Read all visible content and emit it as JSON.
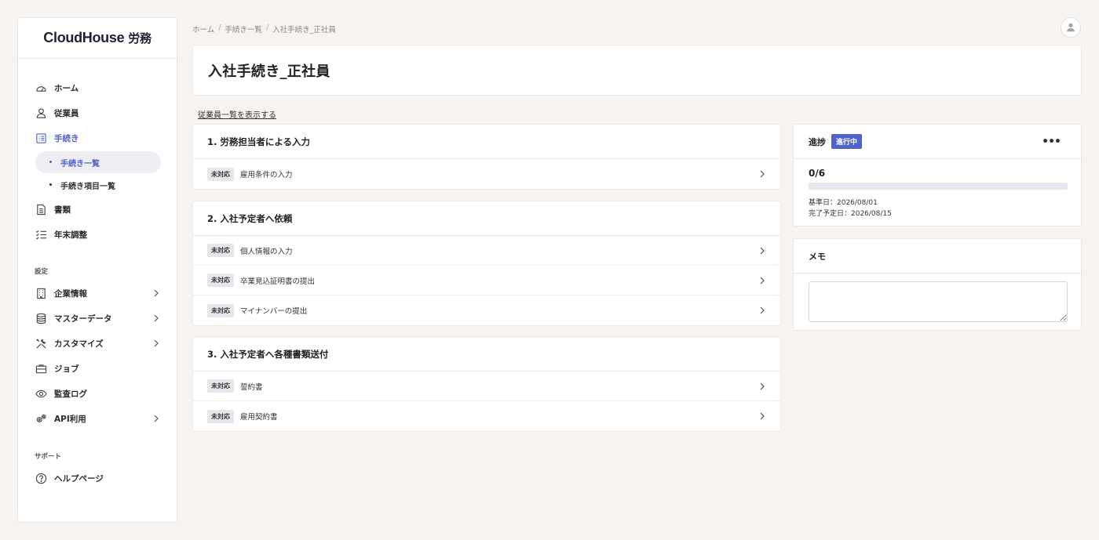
{
  "app": {
    "logo_main": "CloudHouse",
    "logo_suffix": "労務"
  },
  "sidebar": {
    "items": [
      {
        "label": "ホーム",
        "icon": "gauge-icon"
      },
      {
        "label": "従業員",
        "icon": "user-icon"
      },
      {
        "label": "手続き",
        "icon": "checklist-icon",
        "active": true
      },
      {
        "label": "書類",
        "icon": "document-icon"
      },
      {
        "label": "年末調整",
        "icon": "list-check-icon"
      }
    ],
    "subitems": [
      {
        "label": "手続き一覧",
        "active": true
      },
      {
        "label": "手続き項目一覧"
      }
    ],
    "settings_label": "設定",
    "settings_items": [
      {
        "label": "企業情報",
        "icon": "building-icon"
      },
      {
        "label": "マスターデータ",
        "icon": "database-icon"
      },
      {
        "label": "カスタマイズ",
        "icon": "tools-icon"
      },
      {
        "label": "ジョブ",
        "icon": "briefcase-icon"
      },
      {
        "label": "監査ログ",
        "icon": "eye-icon"
      },
      {
        "label": "API利用",
        "icon": "gears-icon"
      }
    ],
    "support_label": "サポート",
    "support_items": [
      {
        "label": "ヘルプページ",
        "icon": "help-circle-icon"
      }
    ]
  },
  "breadcrumb": [
    "ホーム",
    "手続き一覧",
    "入社手続き_正社員"
  ],
  "page": {
    "title": "入社手続き_正社員",
    "employee_link": "従業員一覧を表示する"
  },
  "steps": [
    {
      "title": "1. 労務担当者による入力",
      "tasks": [
        {
          "status": "未対応",
          "label": "雇用条件の入力"
        }
      ]
    },
    {
      "title": "2. 入社予定者へ依頼",
      "tasks": [
        {
          "status": "未対応",
          "label": "個人情報の入力"
        },
        {
          "status": "未対応",
          "label": "卒業見込証明書の提出"
        },
        {
          "status": "未対応",
          "label": "マイナンバーの提出"
        }
      ]
    },
    {
      "title": "3. 入社予定者へ各種書類送付",
      "tasks": [
        {
          "status": "未対応",
          "label": "誓約書"
        },
        {
          "status": "未対応",
          "label": "雇用契約書"
        }
      ]
    }
  ],
  "progress": {
    "title": "進捗",
    "status": "進行中",
    "more": "•••",
    "count": "0/6",
    "fraction": 0,
    "base_date": "基準日：2026/08/01",
    "due_date": "完了予定日：2026/08/15"
  },
  "memo": {
    "title": "メモ",
    "value": ""
  },
  "colors": {
    "accent": "#4f63c8",
    "background": "#f6f3f1"
  }
}
